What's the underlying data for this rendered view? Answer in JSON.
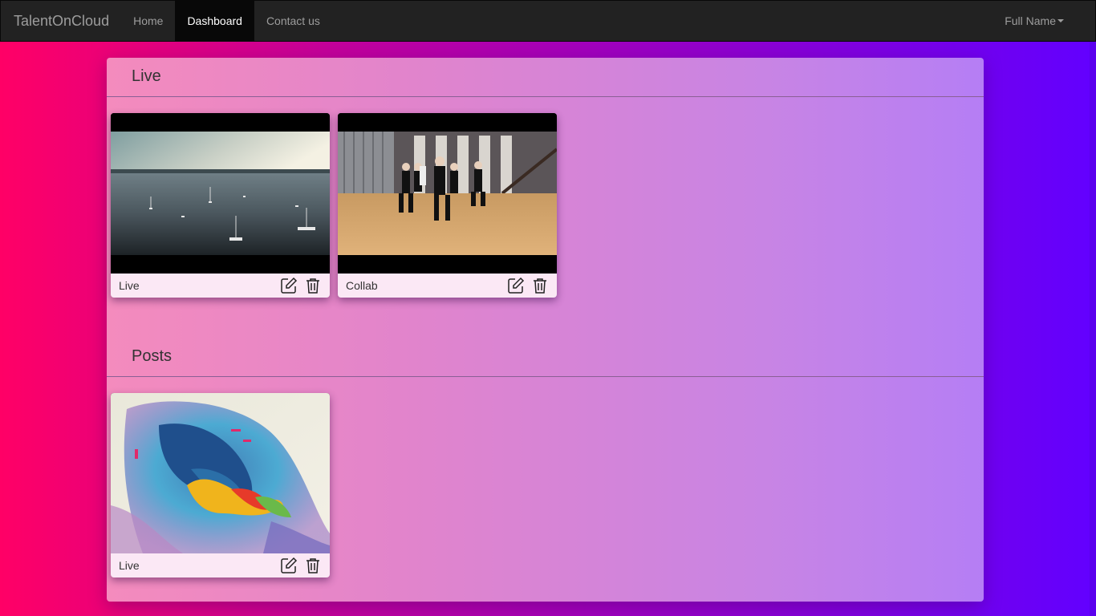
{
  "navbar": {
    "brand": "TalentOnCloud",
    "links": [
      {
        "label": "Home",
        "active": false
      },
      {
        "label": "Dashboard",
        "active": true
      },
      {
        "label": "Contact us",
        "active": false
      }
    ],
    "user_menu": "Full Name"
  },
  "sections": {
    "live": {
      "title": "Live",
      "cards": [
        {
          "label": "Live",
          "media": "video-lake-boats"
        },
        {
          "label": "Collab",
          "media": "video-dance-studio"
        }
      ]
    },
    "posts": {
      "title": "Posts",
      "cards": [
        {
          "label": "Live",
          "media": "image-watercolor-horse"
        }
      ]
    }
  },
  "icons": [
    "edit-icon",
    "trash-icon",
    "caret-down-icon"
  ],
  "colors": {
    "navbar_bg": "#222222",
    "active_link_bg": "#080808",
    "background_left": "#ff0066",
    "background_right": "#6200ff"
  }
}
